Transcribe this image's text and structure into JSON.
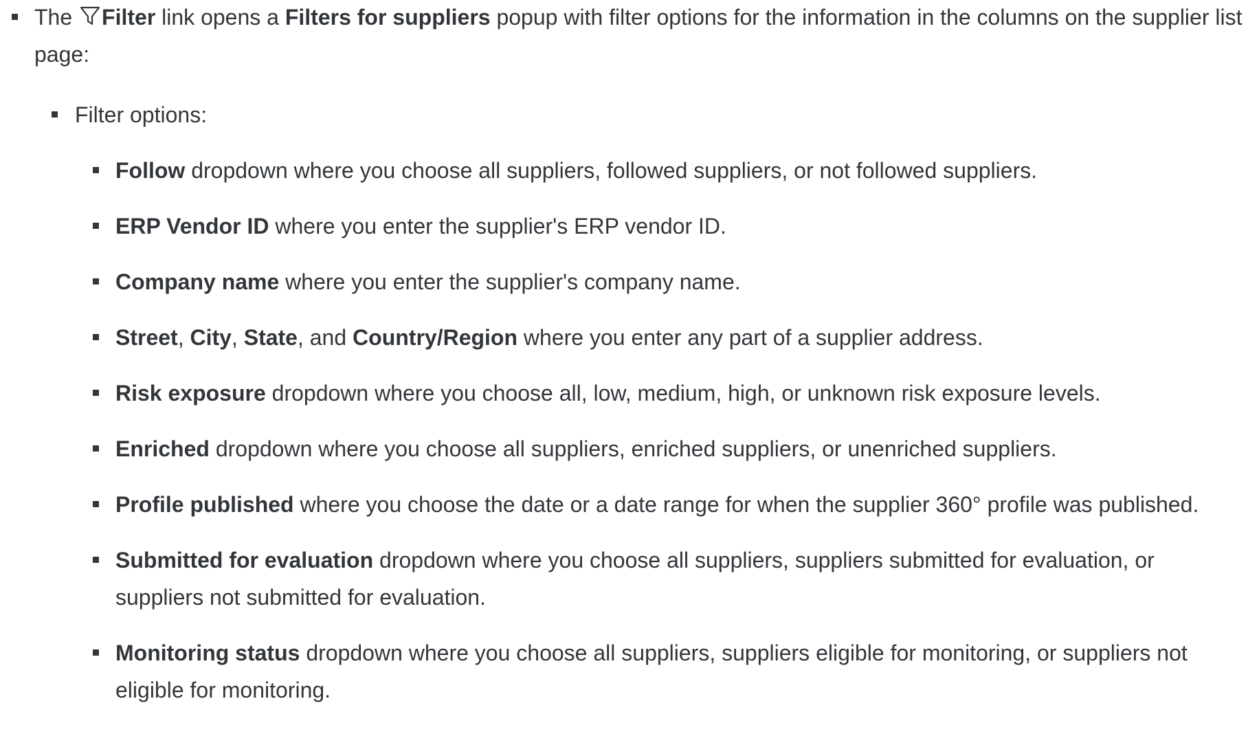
{
  "intro": {
    "prefix": "The ",
    "filter_icon": "filter-funnel-icon",
    "filter_label": "Filter",
    "middle": " link opens a ",
    "popup_name": "Filters for suppliers",
    "suffix": " popup with filter options for the information in the columns on the supplier list page:"
  },
  "filter_options_heading": "Filter options:",
  "options": {
    "follow": {
      "name": "Follow",
      "text": " dropdown where you choose all suppliers, followed suppliers, or not followed suppliers."
    },
    "erp": {
      "name": "ERP Vendor ID",
      "text": " where you enter the supplier's ERP vendor ID."
    },
    "company": {
      "name": "Company name",
      "text": " where you enter the supplier's company name."
    },
    "address": {
      "street": "Street",
      "sep1": ", ",
      "city": "City",
      "sep2": ", ",
      "state": "State",
      "sep3": ", and ",
      "country": "Country/Region",
      "text": " where you enter any part of a supplier address."
    },
    "risk": {
      "name": "Risk exposure",
      "text": " dropdown where you choose all, low, medium, high, or unknown risk exposure levels."
    },
    "enriched": {
      "name": "Enriched",
      "text": " dropdown where you choose all suppliers, enriched suppliers, or unenriched suppliers."
    },
    "profile": {
      "name": "Profile published",
      "text": " where you choose the date or a date range for when the supplier 360° profile was published."
    },
    "submitted": {
      "name": "Submitted for evaluation",
      "text": " dropdown where you choose all suppliers, suppliers submitted for evaluation, or suppliers not submitted for evaluation."
    },
    "monitoring": {
      "name": "Monitoring status",
      "text": " dropdown where you choose all suppliers, suppliers eligible for monitoring, or suppliers not eligible for monitoring."
    }
  }
}
